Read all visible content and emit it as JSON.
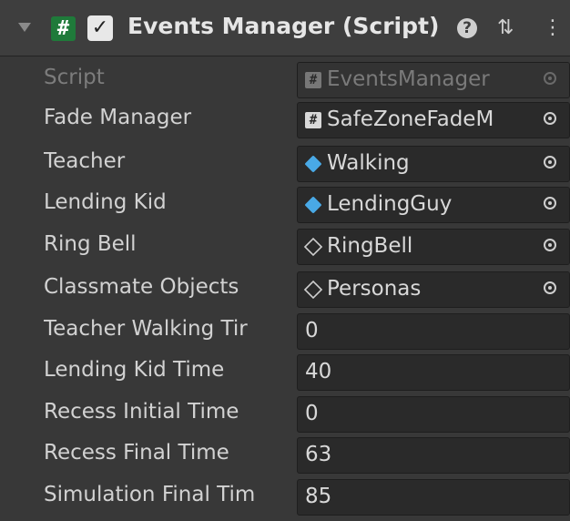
{
  "component": {
    "title": "Events Manager (Script)",
    "script_icon_glyph": "#",
    "enabled_glyph": "✓",
    "help_glyph": "?",
    "presets_glyph": "⇅",
    "menu_glyph": "⋮"
  },
  "fields": [
    {
      "label": "Script",
      "value": "EventsManager",
      "icon": "script-icon",
      "type": "object",
      "disabled": true
    },
    {
      "label": "Fade Manager",
      "value": "SafeZoneFadeM",
      "icon": "script-icon",
      "type": "object"
    },
    {
      "label": "Teacher",
      "value": "Walking",
      "icon": "prefab-icon",
      "type": "object"
    },
    {
      "label": "Lending Kid",
      "value": "LendingGuy",
      "icon": "prefab-icon",
      "type": "object"
    },
    {
      "label": "Ring Bell",
      "value": "RingBell",
      "icon": "gameobject-icon",
      "type": "object"
    },
    {
      "label": "Classmate Objects",
      "value": "Personas",
      "icon": "gameobject-icon",
      "type": "object"
    },
    {
      "label": "Teacher Walking Tir",
      "value": "0",
      "type": "number"
    },
    {
      "label": "Lending Kid Time",
      "value": "40",
      "type": "number"
    },
    {
      "label": "Recess Initial Time",
      "value": "0",
      "type": "number"
    },
    {
      "label": "Recess Final Time",
      "value": "63",
      "type": "number"
    },
    {
      "label": "Simulation Final Tim",
      "value": "85",
      "type": "number"
    }
  ],
  "script_icon_letter": "#"
}
